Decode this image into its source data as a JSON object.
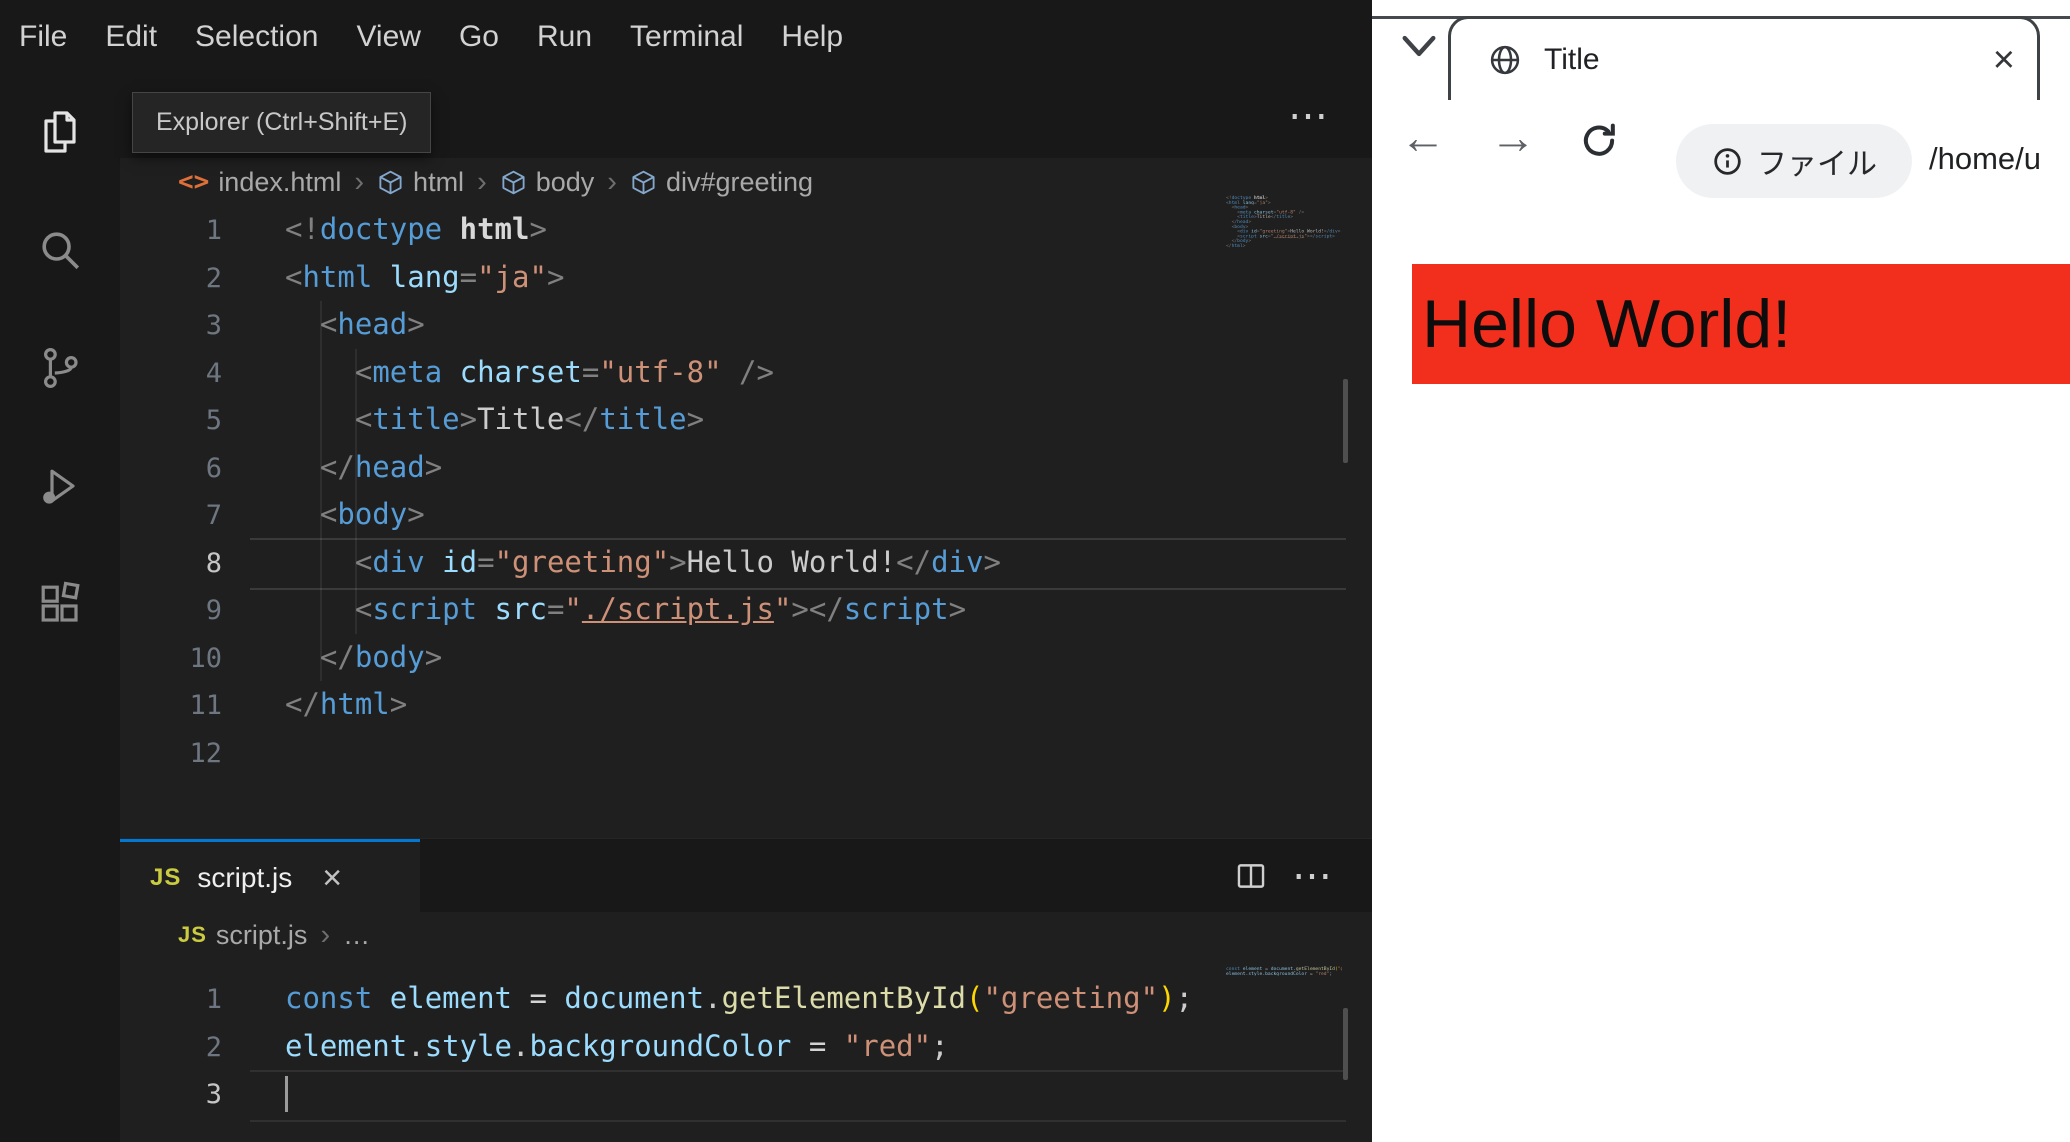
{
  "vscode": {
    "menu": [
      "File",
      "Edit",
      "Selection",
      "View",
      "Go",
      "Run",
      "Terminal",
      "Help"
    ],
    "tooltip": "Explorer (Ctrl+Shift+E)",
    "activity": [
      {
        "name": "explorer",
        "active": true
      },
      {
        "name": "search",
        "active": false
      },
      {
        "name": "source-control",
        "active": false
      },
      {
        "name": "run-debug",
        "active": false
      },
      {
        "name": "extensions",
        "active": false
      }
    ],
    "crumb_sep": "›",
    "more_icon": "⋯",
    "html_editor": {
      "breadcrumbs": [
        {
          "icon": "html-file",
          "label": "index.html"
        },
        {
          "icon": "cube",
          "label": "html"
        },
        {
          "icon": "cube",
          "label": "body"
        },
        {
          "icon": "cube",
          "label": "div#greeting"
        }
      ],
      "active_line": 8,
      "lines": [
        [
          [
            "p",
            "<!"
          ],
          [
            "tag",
            "doctype"
          ],
          [
            "plain",
            " "
          ],
          [
            "plainb",
            "html"
          ],
          [
            "p",
            ">"
          ]
        ],
        [
          [
            "p",
            "<"
          ],
          [
            "tag",
            "html"
          ],
          [
            "plain",
            " "
          ],
          [
            "attr",
            "lang"
          ],
          [
            "p",
            "="
          ],
          [
            "str",
            "\"ja\""
          ],
          [
            "p",
            ">"
          ]
        ],
        [
          [
            "plain",
            "  "
          ],
          [
            "p",
            "<"
          ],
          [
            "tag",
            "head"
          ],
          [
            "p",
            ">"
          ]
        ],
        [
          [
            "plain",
            "    "
          ],
          [
            "p",
            "<"
          ],
          [
            "tag",
            "meta"
          ],
          [
            "plain",
            " "
          ],
          [
            "attr",
            "charset"
          ],
          [
            "p",
            "="
          ],
          [
            "str",
            "\"utf-8\""
          ],
          [
            "plain",
            " "
          ],
          [
            "p",
            "/>"
          ]
        ],
        [
          [
            "plain",
            "    "
          ],
          [
            "p",
            "<"
          ],
          [
            "tag",
            "title"
          ],
          [
            "p",
            ">"
          ],
          [
            "plain",
            "Title"
          ],
          [
            "p",
            "</"
          ],
          [
            "tag",
            "title"
          ],
          [
            "p",
            ">"
          ]
        ],
        [
          [
            "plain",
            "  "
          ],
          [
            "p",
            "</"
          ],
          [
            "tag",
            "head"
          ],
          [
            "p",
            ">"
          ]
        ],
        [
          [
            "plain",
            "  "
          ],
          [
            "p",
            "<"
          ],
          [
            "tag",
            "body"
          ],
          [
            "p",
            ">"
          ]
        ],
        [
          [
            "plain",
            "    "
          ],
          [
            "p",
            "<"
          ],
          [
            "tag",
            "div"
          ],
          [
            "plain",
            " "
          ],
          [
            "attr",
            "id"
          ],
          [
            "p",
            "="
          ],
          [
            "str",
            "\"greeting\""
          ],
          [
            "p",
            ">"
          ],
          [
            "plain",
            "Hello World!"
          ],
          [
            "p",
            "</"
          ],
          [
            "tag",
            "div"
          ],
          [
            "p",
            ">"
          ]
        ],
        [
          [
            "plain",
            "    "
          ],
          [
            "p",
            "<"
          ],
          [
            "tag",
            "script"
          ],
          [
            "plain",
            " "
          ],
          [
            "attr",
            "src"
          ],
          [
            "p",
            "="
          ],
          [
            "str",
            "\""
          ],
          [
            "link",
            "./script.js"
          ],
          [
            "str",
            "\""
          ],
          [
            "p",
            ">"
          ],
          [
            "p",
            "</"
          ],
          [
            "tag",
            "script"
          ],
          [
            "p",
            ">"
          ]
        ],
        [
          [
            "plain",
            "  "
          ],
          [
            "p",
            "</"
          ],
          [
            "tag",
            "body"
          ],
          [
            "p",
            ">"
          ]
        ],
        [
          [
            "p",
            "</"
          ],
          [
            "tag",
            "html"
          ],
          [
            "p",
            ">"
          ]
        ],
        []
      ]
    },
    "panel": {
      "tab": {
        "icon": "js",
        "label": "script.js",
        "close": "×"
      },
      "breadcrumbs": [
        {
          "icon": "js",
          "label": "script.js"
        },
        {
          "icon": null,
          "label": "…"
        }
      ],
      "active_line": 3,
      "lines": [
        [
          [
            "kw",
            "const"
          ],
          [
            "plain",
            " "
          ],
          [
            "var",
            "element"
          ],
          [
            "plain",
            " "
          ],
          [
            "op",
            "="
          ],
          [
            "plain",
            " "
          ],
          [
            "var",
            "document"
          ],
          [
            "plain",
            "."
          ],
          [
            "fn",
            "getElementById"
          ],
          [
            "br",
            "("
          ],
          [
            "str",
            "\"greeting\""
          ],
          [
            "br",
            ")"
          ],
          [
            "plain",
            ";"
          ]
        ],
        [
          [
            "var",
            "element"
          ],
          [
            "plain",
            "."
          ],
          [
            "var",
            "style"
          ],
          [
            "plain",
            "."
          ],
          [
            "var",
            "backgroundColor"
          ],
          [
            "plain",
            " "
          ],
          [
            "op",
            "="
          ],
          [
            "plain",
            " "
          ],
          [
            "str",
            "\"red\""
          ],
          [
            "plain",
            ";"
          ]
        ],
        []
      ]
    }
  },
  "browser": {
    "tab": {
      "title": "Title",
      "close": "×"
    },
    "toolbar": {
      "back": "←",
      "forward": "→",
      "chip_label": "ファイル",
      "url": "/home/u"
    },
    "page": {
      "heading": "Hello World!",
      "heading_bg": "#f22e1c",
      "text_color": "#0d0d0d"
    }
  }
}
